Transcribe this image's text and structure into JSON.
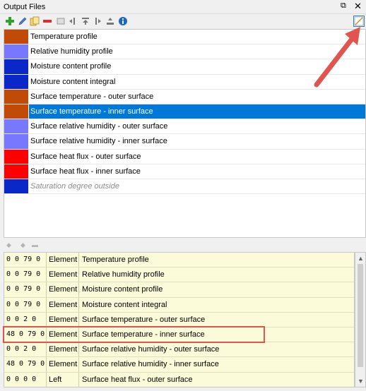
{
  "panel": {
    "title": "Output Files",
    "float_glyph": "⧉",
    "close_glyph": "✕"
  },
  "toolbar": {
    "icons": [
      "add-icon",
      "edit-icon",
      "copy-icon",
      "remove-icon",
      "image-icon",
      "move-left-icon",
      "move-up-icon",
      "move-right-icon",
      "export-icon",
      "info-icon"
    ],
    "right_icon": "chart-edit-icon"
  },
  "outputs": [
    {
      "label": "Temperature profile",
      "color": "#c04a06"
    },
    {
      "label": "Relative humidity profile",
      "color": "#7878ff"
    },
    {
      "label": "Moisture content profile",
      "color": "#0a28c8"
    },
    {
      "label": "Moisture content integral",
      "color": "#0a28c8"
    },
    {
      "label": "Surface temperature - outer surface",
      "color": "#c04a06"
    },
    {
      "label": "Surface temperature - inner surface",
      "color": "#c04a06",
      "selected": true
    },
    {
      "label": "Surface relative humidity - outer surface",
      "color": "#7878ff"
    },
    {
      "label": "Surface relative humidity - inner surface",
      "color": "#7878ff"
    },
    {
      "label": "Surface heat flux - outer surface",
      "color": "#ff0000"
    },
    {
      "label": "Surface heat flux - inner surface",
      "color": "#ff0000"
    },
    {
      "label": "Saturation degree outside",
      "color": "#0a28c8",
      "muted": true
    }
  ],
  "details": [
    {
      "pos": "0 0 79 0",
      "type": "Element",
      "name": "Temperature profile"
    },
    {
      "pos": "0 0 79 0",
      "type": "Element",
      "name": "Relative humidity profile"
    },
    {
      "pos": "0 0 79 0",
      "type": "Element",
      "name": "Moisture content profile"
    },
    {
      "pos": "0 0 79 0",
      "type": "Element",
      "name": "Moisture content integral"
    },
    {
      "pos": "0 0 2 0",
      "type": "Element",
      "name": "Surface temperature - outer surface"
    },
    {
      "pos": "48 0 79 0",
      "type": "Element",
      "name": "Surface temperature - inner surface",
      "highlighted": true
    },
    {
      "pos": "0 0 2 0",
      "type": "Element",
      "name": "Surface relative humidity - outer surface"
    },
    {
      "pos": "48 0 79 0",
      "type": "Element",
      "name": "Surface relative humidity - inner surface"
    },
    {
      "pos": "0 0 0 0",
      "type": "Left",
      "name": "Surface heat flux - outer surface"
    }
  ],
  "colors": {
    "selection": "#0078d7",
    "detail_bg": "#fbfbd9",
    "annotation": "#e05550"
  }
}
